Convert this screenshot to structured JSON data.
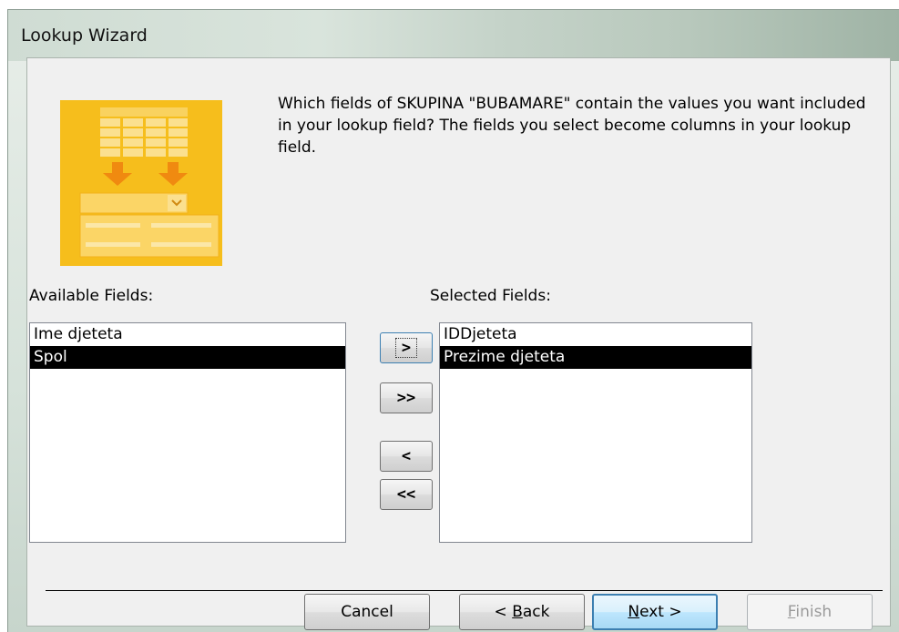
{
  "window": {
    "title": "Lookup Wizard"
  },
  "instruction": "Which fields of SKUPINA \"BUBAMARE\" contain the values you want included in your lookup field? The fields you select become columns in your lookup field.",
  "available": {
    "label": "Available Fields:",
    "items": [
      {
        "label": "Ime djeteta",
        "selected": false
      },
      {
        "label": "Spol",
        "selected": true
      }
    ]
  },
  "selected": {
    "label": "Selected Fields:",
    "items": [
      {
        "label": "IDDjeteta",
        "selected": false
      },
      {
        "label": "Prezime djeteta",
        "selected": true
      }
    ]
  },
  "move_buttons": {
    "add": ">",
    "add_all": ">>",
    "remove": "<",
    "remove_all": "<<"
  },
  "footer": {
    "cancel": "Cancel",
    "back_prefix": "< ",
    "back_key": "B",
    "back_rest": "ack",
    "next_key": "N",
    "next_rest": "ext >",
    "finish_key": "F",
    "finish_rest": "inish"
  },
  "colors": {
    "illustration": "#f6be1c",
    "selection": "#000000",
    "default_button_border": "#3c7fb1"
  },
  "icons": [
    "lookup-wizard-illustration-icon"
  ]
}
